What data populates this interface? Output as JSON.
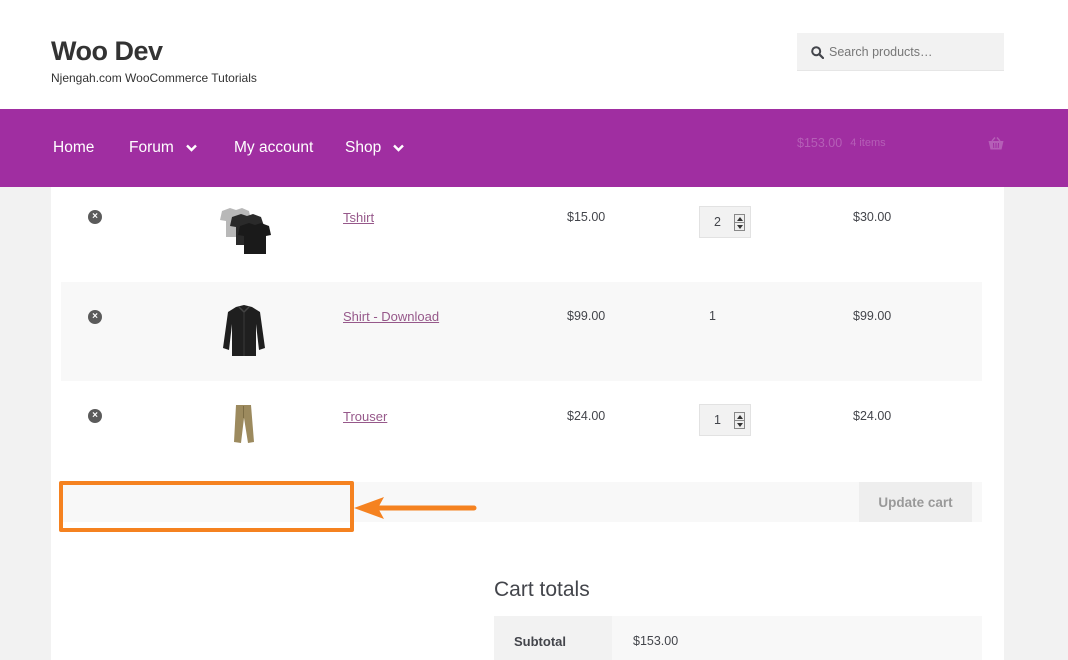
{
  "site": {
    "title": "Woo Dev",
    "tagline": "Njengah.com WooCommerce Tutorials"
  },
  "search": {
    "placeholder": "Search products…",
    "icon": "search-icon"
  },
  "nav": {
    "items": [
      {
        "label": "Home",
        "has_dropdown": false
      },
      {
        "label": "Forum",
        "has_dropdown": true
      },
      {
        "label": "My account",
        "has_dropdown": false
      },
      {
        "label": "Shop",
        "has_dropdown": true
      }
    ],
    "mini_cart": {
      "amount": "$153.00",
      "count": "4 items",
      "icon": "basket-icon"
    }
  },
  "cart": {
    "items": [
      {
        "name": "Tshirt",
        "price": "$15.00",
        "quantity": "2",
        "quantity_editable": true,
        "subtotal": "$30.00",
        "image": "tshirt-thumbnail"
      },
      {
        "name": "Shirt - Download",
        "price": "$99.00",
        "quantity": "1",
        "quantity_editable": false,
        "subtotal": "$99.00",
        "image": "shirt-thumbnail"
      },
      {
        "name": "Trouser",
        "price": "$24.00",
        "quantity": "1",
        "quantity_editable": true,
        "subtotal": "$24.00",
        "image": "trouser-thumbnail"
      }
    ],
    "update_button": "Update cart"
  },
  "totals": {
    "title": "Cart totals",
    "subtotal_label": "Subtotal",
    "subtotal_value": "$153.00"
  },
  "colors": {
    "nav_background": "#a02ea1",
    "link": "#96588a",
    "annotation": "#f58220"
  }
}
